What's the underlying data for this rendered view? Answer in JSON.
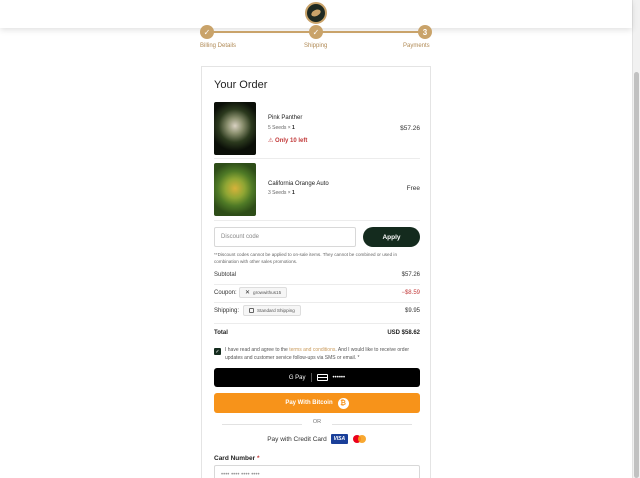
{
  "progress": {
    "steps": [
      {
        "label": "Billing Details",
        "marker": "✓"
      },
      {
        "label": "Shipping",
        "marker": "✓"
      },
      {
        "label": "Payments",
        "marker": "3"
      }
    ]
  },
  "order": {
    "title": "Your Order",
    "items": [
      {
        "name": "Pink Panther",
        "qty_prefix": "5 Seeds × ",
        "qty": "1",
        "warning": "⚠ Only 10 left",
        "price": "$57.26"
      },
      {
        "name": "California Orange Auto",
        "qty_prefix": "3 Seeds × ",
        "qty": "1",
        "price": "Free"
      }
    ],
    "discount": {
      "placeholder": "Discount code",
      "apply_label": "Apply",
      "note": "**Discount codes cannot be applied to on-sale items. They cannot be combined or used in combination with other sales promotions."
    },
    "summary": {
      "subtotal_label": "Subtotal",
      "subtotal_value": "$57.26",
      "coupon_label": "Coupon:",
      "coupon_code": "growwithus15",
      "coupon_value": "−$8.59",
      "shipping_label": "Shipping:",
      "shipping_method": "Standard Shipping",
      "shipping_value": "$9.95",
      "total_label": "Total",
      "total_value": "USD $58.62"
    },
    "agreement": {
      "text_before": "I have read and agree to the ",
      "link": "terms and conditions",
      "text_after": ". And I would like to receive order updates and customer service follow-ups via SMS or email. *"
    },
    "gpay": {
      "label": "G Pay",
      "card_mask": "••••••"
    },
    "bitcoin": {
      "label": "Pay With Bitcoin",
      "icon": "₿"
    },
    "or_label": "OR",
    "credit_card": {
      "label": "Pay with Credit Card",
      "visa": "VISA",
      "card_number_label": "Card Number",
      "required_mark": "*",
      "card_number_placeholder": "•••• •••• •••• ••••"
    }
  }
}
